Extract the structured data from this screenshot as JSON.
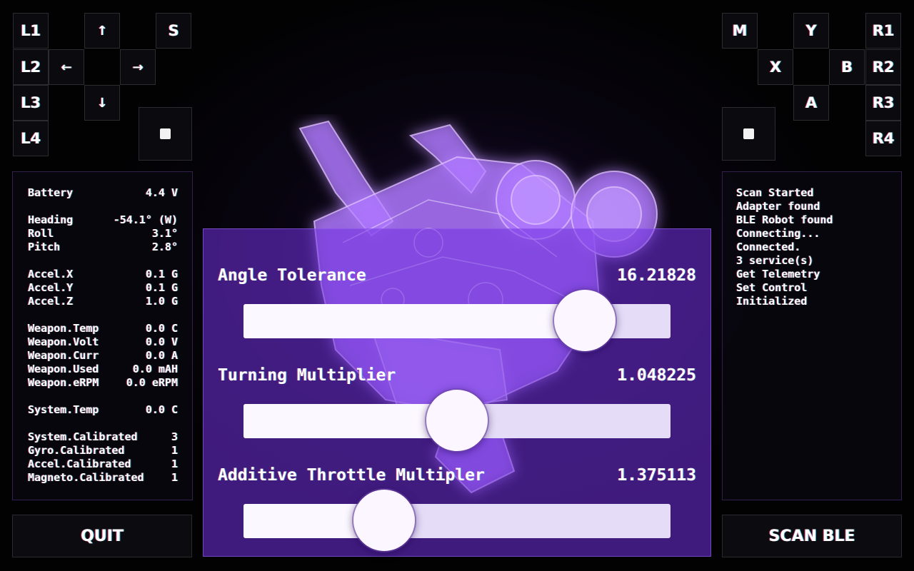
{
  "left_controls": {
    "L1": "L1",
    "L2": "L2",
    "L3": "L3",
    "L4": "L4",
    "up": "↑",
    "down": "↓",
    "left": "←",
    "right": "→",
    "S": "S"
  },
  "right_controls": {
    "M": "M",
    "Y": "Y",
    "X": "X",
    "B": "B",
    "A": "A",
    "R1": "R1",
    "R2": "R2",
    "R3": "R3",
    "R4": "R4"
  },
  "telemetry": [
    [
      {
        "label": "Battery",
        "value": "4.4 V"
      }
    ],
    [
      {
        "label": "Heading",
        "value": "-54.1° (W)"
      },
      {
        "label": "Roll",
        "value": "3.1°"
      },
      {
        "label": "Pitch",
        "value": "2.8°"
      }
    ],
    [
      {
        "label": "Accel.X",
        "value": "0.1 G"
      },
      {
        "label": "Accel.Y",
        "value": "0.1 G"
      },
      {
        "label": "Accel.Z",
        "value": "1.0 G"
      }
    ],
    [
      {
        "label": "Weapon.Temp",
        "value": "0.0 C"
      },
      {
        "label": "Weapon.Volt",
        "value": "0.0 V"
      },
      {
        "label": "Weapon.Curr",
        "value": "0.0 A"
      },
      {
        "label": "Weapon.Used",
        "value": "0.0 mAH"
      },
      {
        "label": "Weapon.eRPM",
        "value": "0.0 eRPM"
      }
    ],
    [
      {
        "label": "System.Temp",
        "value": "0.0 C"
      }
    ],
    [
      {
        "label": "System.Calibrated",
        "value": "3"
      },
      {
        "label": "Gyro.Calibrated",
        "value": "1"
      },
      {
        "label": "Accel.Calibrated",
        "value": "1"
      },
      {
        "label": "Magneto.Calibrated",
        "value": "1"
      }
    ]
  ],
  "log": [
    "Scan Started",
    "Adapter found",
    "BLE Robot found",
    "Connecting...",
    "Connected.",
    "3 service(s)",
    "Get Telemetry",
    "Set Control",
    "Initialized"
  ],
  "sliders": [
    {
      "label": "Angle Tolerance",
      "value": "16.21828",
      "position": 0.8
    },
    {
      "label": "Turning Multiplier",
      "value": "1.048225",
      "position": 0.5
    },
    {
      "label": "Additive Throttle Multipler",
      "value": "1.375113",
      "position": 0.33
    }
  ],
  "buttons": {
    "quit": "QUIT",
    "scan": "SCAN BLE"
  },
  "icons": {
    "left_stop": "stop-square-icon",
    "right_stop": "stop-square-icon"
  },
  "colors": {
    "slider_panel": "#7332e1",
    "background": "#050308",
    "glow": "#a56bff"
  }
}
